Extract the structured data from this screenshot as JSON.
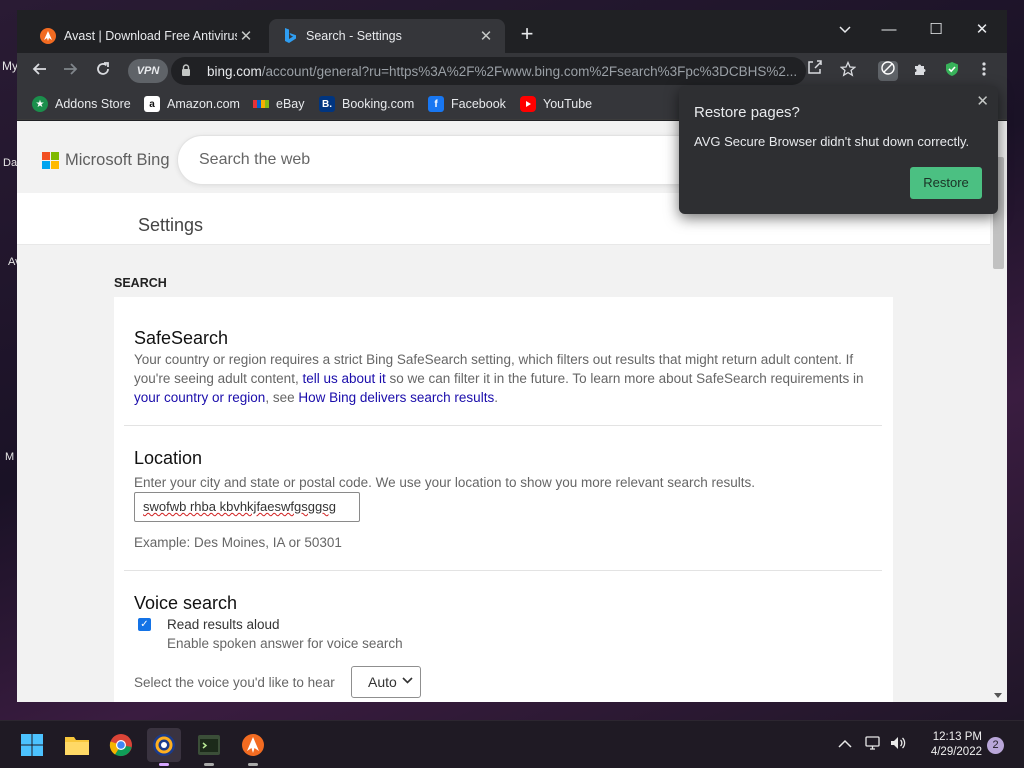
{
  "desktop": {
    "labels": [
      "My",
      "Da",
      "Av",
      "M"
    ]
  },
  "browser": {
    "tabs": [
      {
        "title": "Avast | Download Free Antivirus & ",
        "favicon": "avast-icon",
        "active": false
      },
      {
        "title": "Search - Settings",
        "favicon": "bing-icon",
        "active": true
      }
    ],
    "window_controls": {
      "minimize": "—",
      "maximize": "☐",
      "close": "✕"
    },
    "vpn_label": "VPN",
    "address": {
      "host": "bing.com",
      "path": "/account/general?ru=https%3A%2F%2Fwww.bing.com%2Fsearch%3Fpc%3DCBHS%2..."
    },
    "bookmarks": [
      {
        "label": "Addons Store",
        "icon": "addons-store-icon"
      },
      {
        "label": "Amazon.com",
        "icon": "amazon-icon"
      },
      {
        "label": "eBay",
        "icon": "ebay-icon"
      },
      {
        "label": "Booking.com",
        "icon": "booking-icon"
      },
      {
        "label": "Facebook",
        "icon": "facebook-icon"
      },
      {
        "label": "YouTube",
        "icon": "youtube-icon"
      }
    ]
  },
  "bing": {
    "logo_text": "Microsoft Bing",
    "search_placeholder": "Search the web",
    "settings_title": "Settings",
    "section_heading": "SEARCH",
    "safesearch": {
      "title": "SafeSearch",
      "text1": "Your country or region requires a strict Bing SafeSearch setting, which filters out results that might return adult content. If you're seeing adult content, ",
      "link1": "tell us about it",
      "text2": " so we can filter it in the future. To learn more about SafeSearch requirements in ",
      "link2": "your country or region",
      "text3": ", see ",
      "link3": "How Bing delivers search results",
      "text4": "."
    },
    "location": {
      "title": "Location",
      "description": "Enter your city and state or postal code. We use your location to show you more relevant search results.",
      "input_value": "swofwb rhba kbvhkjfaeswfgsggsg",
      "example": "Example: Des Moines, IA or 50301"
    },
    "voice": {
      "title": "Voice search",
      "read_aloud_label": "Read results aloud",
      "read_aloud_checked": true,
      "read_aloud_sub": "Enable spoken answer for voice search",
      "select_label": "Select the voice you'd like to hear",
      "select_value": "Auto"
    }
  },
  "restore_popup": {
    "title": "Restore pages?",
    "message": "AVG Secure Browser didn't shut down correctly.",
    "button": "Restore"
  },
  "taskbar": {
    "time": "12:13 PM",
    "date": "4/29/2022",
    "notification_count": "2"
  },
  "colors": {
    "restore_button": "#4bc082",
    "link": "#1a0dab",
    "checkbox": "#1473e6"
  }
}
